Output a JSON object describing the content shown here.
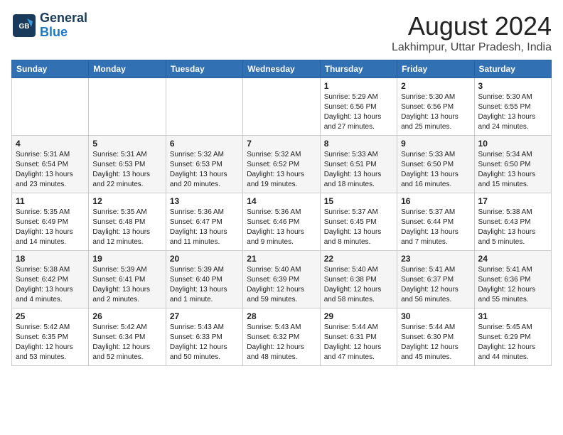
{
  "header": {
    "logo_line1": "General",
    "logo_line2": "Blue",
    "month_title": "August 2024",
    "location": "Lakhimpur, Uttar Pradesh, India"
  },
  "weekdays": [
    "Sunday",
    "Monday",
    "Tuesday",
    "Wednesday",
    "Thursday",
    "Friday",
    "Saturday"
  ],
  "weeks": [
    [
      {
        "day": "",
        "info": ""
      },
      {
        "day": "",
        "info": ""
      },
      {
        "day": "",
        "info": ""
      },
      {
        "day": "",
        "info": ""
      },
      {
        "day": "1",
        "info": "Sunrise: 5:29 AM\nSunset: 6:56 PM\nDaylight: 13 hours\nand 27 minutes."
      },
      {
        "day": "2",
        "info": "Sunrise: 5:30 AM\nSunset: 6:56 PM\nDaylight: 13 hours\nand 25 minutes."
      },
      {
        "day": "3",
        "info": "Sunrise: 5:30 AM\nSunset: 6:55 PM\nDaylight: 13 hours\nand 24 minutes."
      }
    ],
    [
      {
        "day": "4",
        "info": "Sunrise: 5:31 AM\nSunset: 6:54 PM\nDaylight: 13 hours\nand 23 minutes."
      },
      {
        "day": "5",
        "info": "Sunrise: 5:31 AM\nSunset: 6:53 PM\nDaylight: 13 hours\nand 22 minutes."
      },
      {
        "day": "6",
        "info": "Sunrise: 5:32 AM\nSunset: 6:53 PM\nDaylight: 13 hours\nand 20 minutes."
      },
      {
        "day": "7",
        "info": "Sunrise: 5:32 AM\nSunset: 6:52 PM\nDaylight: 13 hours\nand 19 minutes."
      },
      {
        "day": "8",
        "info": "Sunrise: 5:33 AM\nSunset: 6:51 PM\nDaylight: 13 hours\nand 18 minutes."
      },
      {
        "day": "9",
        "info": "Sunrise: 5:33 AM\nSunset: 6:50 PM\nDaylight: 13 hours\nand 16 minutes."
      },
      {
        "day": "10",
        "info": "Sunrise: 5:34 AM\nSunset: 6:50 PM\nDaylight: 13 hours\nand 15 minutes."
      }
    ],
    [
      {
        "day": "11",
        "info": "Sunrise: 5:35 AM\nSunset: 6:49 PM\nDaylight: 13 hours\nand 14 minutes."
      },
      {
        "day": "12",
        "info": "Sunrise: 5:35 AM\nSunset: 6:48 PM\nDaylight: 13 hours\nand 12 minutes."
      },
      {
        "day": "13",
        "info": "Sunrise: 5:36 AM\nSunset: 6:47 PM\nDaylight: 13 hours\nand 11 minutes."
      },
      {
        "day": "14",
        "info": "Sunrise: 5:36 AM\nSunset: 6:46 PM\nDaylight: 13 hours\nand 9 minutes."
      },
      {
        "day": "15",
        "info": "Sunrise: 5:37 AM\nSunset: 6:45 PM\nDaylight: 13 hours\nand 8 minutes."
      },
      {
        "day": "16",
        "info": "Sunrise: 5:37 AM\nSunset: 6:44 PM\nDaylight: 13 hours\nand 7 minutes."
      },
      {
        "day": "17",
        "info": "Sunrise: 5:38 AM\nSunset: 6:43 PM\nDaylight: 13 hours\nand 5 minutes."
      }
    ],
    [
      {
        "day": "18",
        "info": "Sunrise: 5:38 AM\nSunset: 6:42 PM\nDaylight: 13 hours\nand 4 minutes."
      },
      {
        "day": "19",
        "info": "Sunrise: 5:39 AM\nSunset: 6:41 PM\nDaylight: 13 hours\nand 2 minutes."
      },
      {
        "day": "20",
        "info": "Sunrise: 5:39 AM\nSunset: 6:40 PM\nDaylight: 13 hours\nand 1 minute."
      },
      {
        "day": "21",
        "info": "Sunrise: 5:40 AM\nSunset: 6:39 PM\nDaylight: 12 hours\nand 59 minutes."
      },
      {
        "day": "22",
        "info": "Sunrise: 5:40 AM\nSunset: 6:38 PM\nDaylight: 12 hours\nand 58 minutes."
      },
      {
        "day": "23",
        "info": "Sunrise: 5:41 AM\nSunset: 6:37 PM\nDaylight: 12 hours\nand 56 minutes."
      },
      {
        "day": "24",
        "info": "Sunrise: 5:41 AM\nSunset: 6:36 PM\nDaylight: 12 hours\nand 55 minutes."
      }
    ],
    [
      {
        "day": "25",
        "info": "Sunrise: 5:42 AM\nSunset: 6:35 PM\nDaylight: 12 hours\nand 53 minutes."
      },
      {
        "day": "26",
        "info": "Sunrise: 5:42 AM\nSunset: 6:34 PM\nDaylight: 12 hours\nand 52 minutes."
      },
      {
        "day": "27",
        "info": "Sunrise: 5:43 AM\nSunset: 6:33 PM\nDaylight: 12 hours\nand 50 minutes."
      },
      {
        "day": "28",
        "info": "Sunrise: 5:43 AM\nSunset: 6:32 PM\nDaylight: 12 hours\nand 48 minutes."
      },
      {
        "day": "29",
        "info": "Sunrise: 5:44 AM\nSunset: 6:31 PM\nDaylight: 12 hours\nand 47 minutes."
      },
      {
        "day": "30",
        "info": "Sunrise: 5:44 AM\nSunset: 6:30 PM\nDaylight: 12 hours\nand 45 minutes."
      },
      {
        "day": "31",
        "info": "Sunrise: 5:45 AM\nSunset: 6:29 PM\nDaylight: 12 hours\nand 44 minutes."
      }
    ]
  ]
}
